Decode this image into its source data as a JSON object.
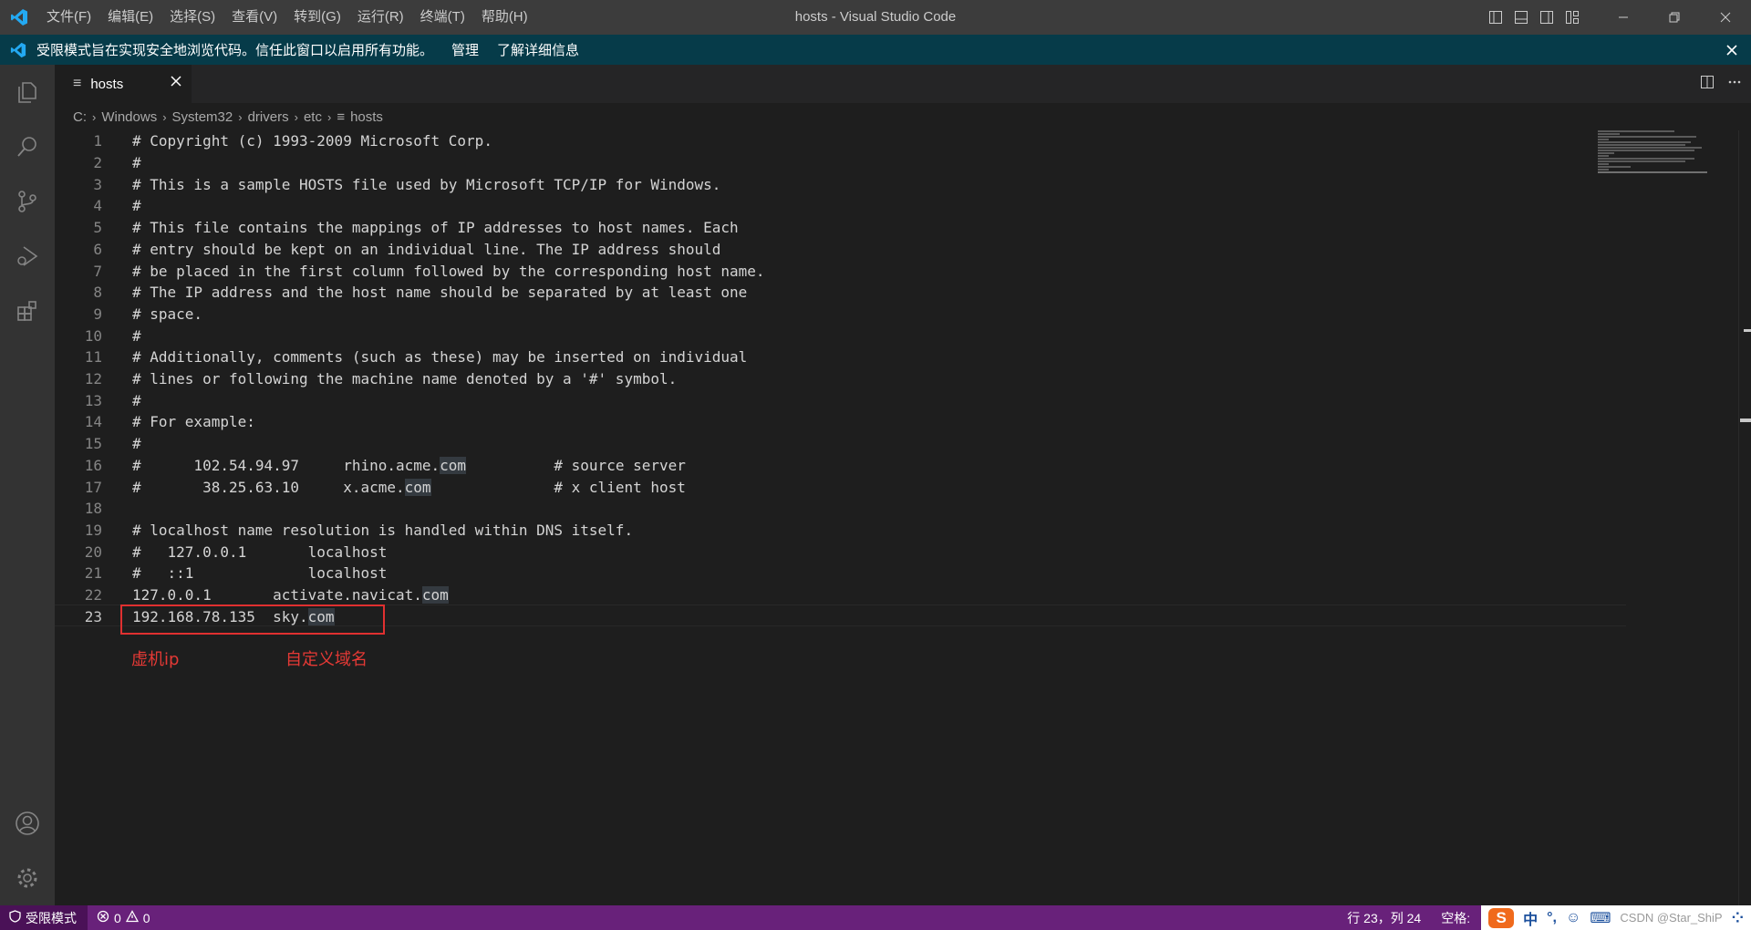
{
  "window": {
    "title": "hosts - Visual Studio Code",
    "menu": [
      "文件(F)",
      "编辑(E)",
      "选择(S)",
      "查看(V)",
      "转到(G)",
      "运行(R)",
      "终端(T)",
      "帮助(H)"
    ]
  },
  "banner": {
    "message": "受限模式旨在实现安全地浏览代码。信任此窗口以启用所有功能。",
    "manage_link": "管理",
    "learn_more_link": "了解详细信息"
  },
  "tab": {
    "label": "hosts",
    "icon": "lines-icon"
  },
  "breadcrumb": [
    "C:",
    "Windows",
    "System32",
    "drivers",
    "etc",
    "hosts"
  ],
  "editor": {
    "active_line": 23,
    "lines": [
      {
        "n": "1",
        "text": "# Copyright (c) 1993-2009 Microsoft Corp."
      },
      {
        "n": "2",
        "text": "#"
      },
      {
        "n": "3",
        "text": "# This is a sample HOSTS file used by Microsoft TCP/IP for Windows."
      },
      {
        "n": "4",
        "text": "#"
      },
      {
        "n": "5",
        "text": "# This file contains the mappings of IP addresses to host names. Each"
      },
      {
        "n": "6",
        "text": "# entry should be kept on an individual line. The IP address should"
      },
      {
        "n": "7",
        "text": "# be placed in the first column followed by the corresponding host name."
      },
      {
        "n": "8",
        "text": "# The IP address and the host name should be separated by at least one"
      },
      {
        "n": "9",
        "text": "# space."
      },
      {
        "n": "10",
        "text": "#"
      },
      {
        "n": "11",
        "text": "# Additionally, comments (such as these) may be inserted on individual"
      },
      {
        "n": "12",
        "text": "# lines or following the machine name denoted by a '#' symbol."
      },
      {
        "n": "13",
        "text": "#"
      },
      {
        "n": "14",
        "text": "# For example:"
      },
      {
        "n": "15",
        "text": "#"
      },
      {
        "n": "16",
        "text": "#      102.54.94.97     rhino.acme.",
        "hl": "com",
        "tail": "          # source server"
      },
      {
        "n": "17",
        "text": "#       38.25.63.10     x.acme.",
        "hl": "com",
        "tail": "              # x client host"
      },
      {
        "n": "18",
        "text": ""
      },
      {
        "n": "19",
        "text": "# localhost name resolution is handled within DNS itself."
      },
      {
        "n": "20",
        "text": "#   127.0.0.1       localhost"
      },
      {
        "n": "21",
        "text": "#   ::1             localhost"
      },
      {
        "n": "22",
        "text": "127.0.0.1       activate.navicat.",
        "hl": "com",
        "tail": ""
      },
      {
        "n": "23",
        "text": "192.168.78.135  sky.",
        "hl": "com",
        "tail": ""
      }
    ]
  },
  "annotations": {
    "ip_label": "虚机ip",
    "domain_label": "自定义域名",
    "color": "#e53935"
  },
  "statusbar": {
    "restricted_label": "受限模式",
    "errors": "0",
    "warnings": "0",
    "position": "行 23，列 24",
    "spaces": "空格:",
    "ime_chars": [
      "中",
      "°,"
    ],
    "watermark": "CSDN @Star_ShiP"
  },
  "colors": {
    "titlebar": "#3c3c3c",
    "banner": "#063b49",
    "activitybar": "#333333",
    "editor_bg": "#1e1e1e",
    "statusbar": "#68217a"
  }
}
